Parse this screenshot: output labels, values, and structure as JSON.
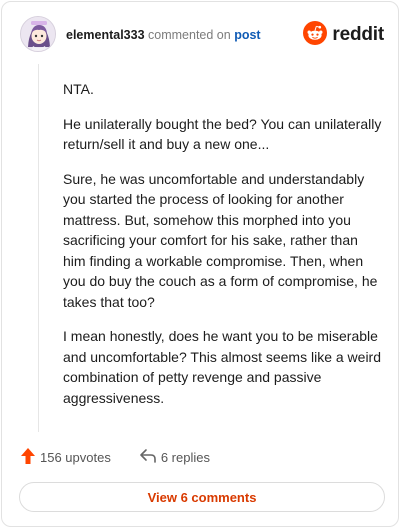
{
  "header": {
    "username": "elemental333",
    "action_text": "commented on",
    "post_link": "post",
    "brand": "reddit"
  },
  "comment": {
    "paragraphs": [
      "NTA.",
      "He unilaterally bought the bed? You can unilaterally return/sell it and buy a new one...",
      "Sure, he was uncomfortable and understandably you started the process of looking for another mattress. But, somehow this morphed into you sacrificing your comfort for his sake, rather than him finding a workable compromise. Then, when you do buy the couch as a form of compromise, he takes that too?",
      "I mean honestly, does he want you to be miserable and uncomfortable? This almost seems like a weird combination of petty revenge and passive aggressiveness."
    ]
  },
  "actions": {
    "upvotes": "156 upvotes",
    "replies": "6 replies"
  },
  "footer": {
    "view_comments": "View 6 comments"
  },
  "colors": {
    "brand_orange": "#ff4500",
    "link_blue": "#0f5bb5",
    "button_text": "#d93a00"
  },
  "icons": {
    "avatar": "user-avatar",
    "logo": "reddit-logo-icon",
    "upvote": "upvote-arrow-icon",
    "reply": "reply-arrow-icon"
  }
}
